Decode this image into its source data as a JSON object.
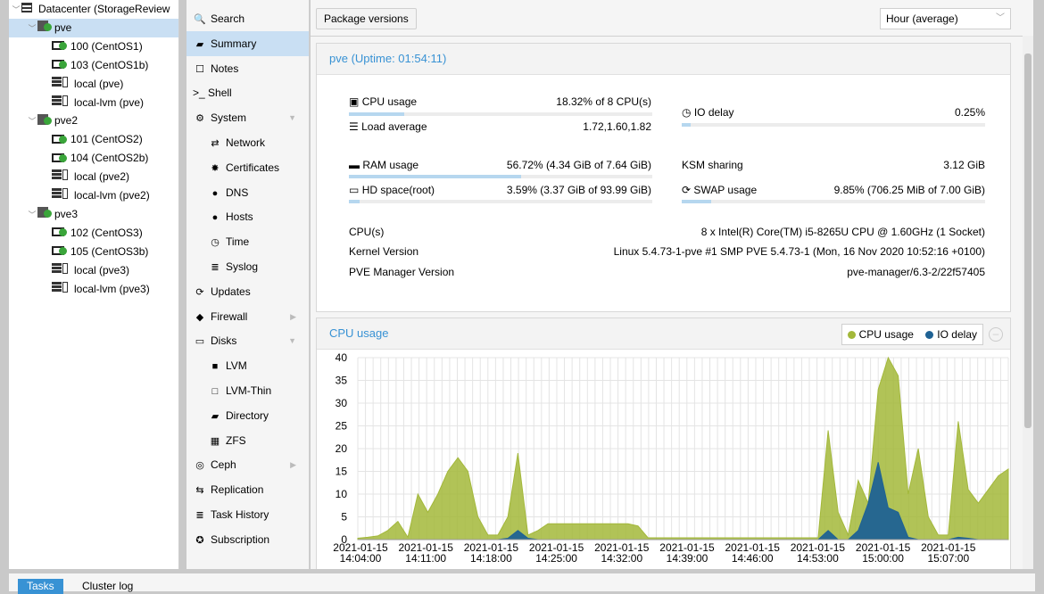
{
  "tree": [
    {
      "label": "Datacenter (StorageReview",
      "icon": "server-icon",
      "level": 0,
      "arrow": true
    },
    {
      "label": "pve",
      "icon": "node-online-icon",
      "level": 1,
      "arrow": true,
      "selected": true
    },
    {
      "label": "100 (CentOS1)",
      "icon": "vm-running-icon",
      "level": 2
    },
    {
      "label": "103 (CentOS1b)",
      "icon": "vm-running-icon",
      "level": 2
    },
    {
      "label": "local (pve)",
      "icon": "storage-icon",
      "level": 2
    },
    {
      "label": "local-lvm (pve)",
      "icon": "storage-icon",
      "level": 2
    },
    {
      "label": "pve2",
      "icon": "node-online-icon",
      "level": 1,
      "arrow": true
    },
    {
      "label": "101 (CentOS2)",
      "icon": "vm-running-icon",
      "level": 2
    },
    {
      "label": "104 (CentOS2b)",
      "icon": "vm-running-icon",
      "level": 2
    },
    {
      "label": "local (pve2)",
      "icon": "storage-icon",
      "level": 2
    },
    {
      "label": "local-lvm (pve2)",
      "icon": "storage-icon",
      "level": 2
    },
    {
      "label": "pve3",
      "icon": "node-online-icon",
      "level": 1,
      "arrow": true
    },
    {
      "label": "102 (CentOS3)",
      "icon": "vm-running-icon",
      "level": 2
    },
    {
      "label": "105 (CentOS3b)",
      "icon": "vm-running-icon",
      "level": 2
    },
    {
      "label": "local (pve3)",
      "icon": "storage-icon",
      "level": 2
    },
    {
      "label": "local-lvm (pve3)",
      "icon": "storage-icon",
      "level": 2
    }
  ],
  "menu": [
    {
      "label": "Search",
      "glyph": "🔍",
      "icon": "search-icon",
      "indent": 0
    },
    {
      "label": "Summary",
      "glyph": "▰",
      "icon": "book-icon",
      "indent": 0,
      "selected": true
    },
    {
      "label": "Notes",
      "glyph": "☐",
      "icon": "notes-icon",
      "indent": 0
    },
    {
      "label": ">_ Shell",
      "glyph": "",
      "icon": "terminal-icon",
      "indent": 0
    },
    {
      "label": "System",
      "glyph": "⚙",
      "icon": "gears-icon",
      "indent": 0,
      "chevron": "▼"
    },
    {
      "label": "Network",
      "glyph": "⇄",
      "icon": "exchange-icon",
      "indent": 1
    },
    {
      "label": "Certificates",
      "glyph": "✸",
      "icon": "certificate-icon",
      "indent": 1
    },
    {
      "label": "DNS",
      "glyph": "●",
      "icon": "globe-icon",
      "indent": 1
    },
    {
      "label": "Hosts",
      "glyph": "●",
      "icon": "globe-icon",
      "indent": 1
    },
    {
      "label": "Time",
      "glyph": "◷",
      "icon": "clock-icon",
      "indent": 1
    },
    {
      "label": "Syslog",
      "glyph": "≣",
      "icon": "list-icon",
      "indent": 1
    },
    {
      "label": "Updates",
      "glyph": "⟳",
      "icon": "refresh-icon",
      "indent": 0
    },
    {
      "label": "Firewall",
      "glyph": "◆",
      "icon": "shield-icon",
      "indent": 0,
      "chevron": "▶"
    },
    {
      "label": "Disks",
      "glyph": "▭",
      "icon": "hdd-icon",
      "indent": 0,
      "chevron": "▼"
    },
    {
      "label": "LVM",
      "glyph": "■",
      "icon": "square-icon",
      "indent": 1
    },
    {
      "label": "LVM-Thin",
      "glyph": "□",
      "icon": "square-outline-icon",
      "indent": 1
    },
    {
      "label": "Directory",
      "glyph": "▰",
      "icon": "folder-icon",
      "indent": 1
    },
    {
      "label": "ZFS",
      "glyph": "▦",
      "icon": "th-large-icon",
      "indent": 1
    },
    {
      "label": "Ceph",
      "glyph": "◎",
      "icon": "ceph-icon",
      "indent": 0,
      "chevron": "▶"
    },
    {
      "label": "Replication",
      "glyph": "⇆",
      "icon": "retweet-icon",
      "indent": 0
    },
    {
      "label": "Task History",
      "glyph": "≣",
      "icon": "list-alt-icon",
      "indent": 0
    },
    {
      "label": "Subscription",
      "glyph": "✪",
      "icon": "support-icon",
      "indent": 0
    }
  ],
  "toolbar": {
    "package_versions": "Package versions",
    "timeframe": "Hour (average)"
  },
  "status": {
    "title": "pve (Uptime: 01:54:11)",
    "cpu_label": "CPU usage",
    "cpu_value": "18.32% of 8 CPU(s)",
    "cpu_fraction": 0.1832,
    "load_label": "Load average",
    "load_value": "1.72,1.60,1.82",
    "io_label": "IO delay",
    "io_value": "0.25%",
    "io_fraction": 0.0025,
    "ram_label": "RAM usage",
    "ram_value": "56.72% (4.34 GiB of 7.64 GiB)",
    "ram_fraction": 0.5672,
    "ksm_label": "KSM sharing",
    "ksm_value": "3.12 GiB",
    "hd_label": "HD space(root)",
    "hd_value": "3.59% (3.37 GiB of 93.99 GiB)",
    "hd_fraction": 0.0359,
    "swap_label": "SWAP usage",
    "swap_value": "9.85% (706.25 MiB of 7.00 GiB)",
    "swap_fraction": 0.0985,
    "cpus_label": "CPU(s)",
    "cpus_value": "8 x Intel(R) Core(TM) i5-8265U CPU @ 1.60GHz (1 Socket)",
    "kernel_label": "Kernel Version",
    "kernel_value": "Linux 5.4.73-1-pve #1 SMP PVE 5.4.73-1 (Mon, 16 Nov 2020 10:52:16 +0100)",
    "pve_label": "PVE Manager Version",
    "pve_value": "pve-manager/6.3-2/22f57405"
  },
  "chart_title": "CPU usage",
  "chart_data": {
    "type": "area",
    "ylim": [
      0,
      40
    ],
    "yticks": [
      0,
      5,
      10,
      15,
      20,
      25,
      30,
      35,
      40
    ],
    "xticks": [
      "2021-01-15 14:04:00",
      "2021-01-15 14:11:00",
      "2021-01-15 14:18:00",
      "2021-01-15 14:25:00",
      "2021-01-15 14:32:00",
      "2021-01-15 14:39:00",
      "2021-01-15 14:46:00",
      "2021-01-15 14:53:00",
      "2021-01-15 15:00:00",
      "2021-01-15 15:07:00"
    ],
    "grid": true,
    "legend": "top-right",
    "series": [
      {
        "name": "CPU usage",
        "color": "#a3b83a",
        "values": [
          0.3,
          0.5,
          0.8,
          2,
          4,
          0.5,
          10,
          6,
          10,
          15,
          18,
          15,
          5,
          1,
          1,
          5,
          19,
          1,
          2,
          3.5,
          3.5,
          3.5,
          3.5,
          3.5,
          3.5,
          3.5,
          3.5,
          3.5,
          3,
          0.4,
          0.4,
          0.4,
          0.4,
          0.4,
          0.4,
          0.4,
          0.4,
          0.4,
          0.4,
          0.4,
          0.4,
          0.4,
          0.4,
          0.4,
          0.4,
          0.4,
          0.4,
          24,
          6,
          1,
          13,
          8,
          33,
          40,
          36,
          10,
          20,
          5,
          1,
          1,
          26,
          11,
          8,
          11,
          14,
          15.5
        ]
      },
      {
        "name": "IO delay",
        "color": "#1f6294",
        "values": [
          0,
          0,
          0,
          0,
          0,
          0,
          0,
          0,
          0,
          0,
          0,
          0,
          0,
          0,
          0,
          0.3,
          2,
          0.3,
          0,
          0,
          0,
          0,
          0,
          0,
          0,
          0,
          0,
          0,
          0,
          0,
          0,
          0,
          0,
          0,
          0,
          0,
          0,
          0,
          0,
          0,
          0,
          0,
          0,
          0,
          0,
          0,
          0,
          2,
          0,
          0,
          2,
          8,
          17,
          7,
          6,
          0.5,
          0,
          0,
          0,
          0,
          0.5,
          0.3,
          0,
          0,
          0,
          0
        ]
      }
    ]
  },
  "bottom_tabs": {
    "tasks": "Tasks",
    "cluster_log": "Cluster log"
  }
}
